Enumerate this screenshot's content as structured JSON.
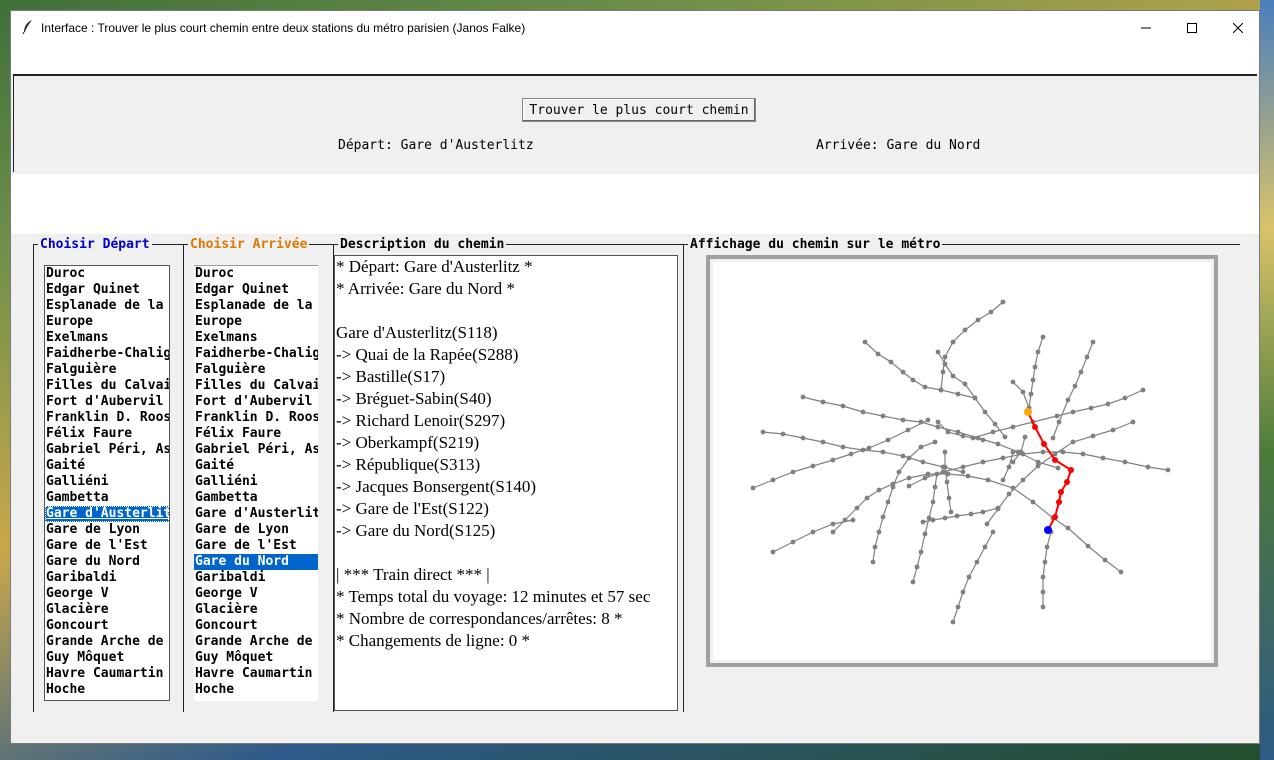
{
  "window": {
    "title": "Interface : Trouver le plus court chemin entre deux stations du métro parisien (Janos Falke)"
  },
  "top": {
    "find_button": "Trouver le plus court chemin",
    "departure_text": "Départ: Gare d'Austerlitz",
    "arrival_text": "Arrivée: Gare du Nord"
  },
  "departure": {
    "legend": "Choisir Départ",
    "legend_color": "#0000cc",
    "items": [
      "Duroc",
      "Edgar Quinet",
      "Esplanade de la",
      "Europe",
      "Exelmans",
      "Faidherbe-Chalig",
      "Falguière",
      "Filles du Calvai",
      "Fort d'Aubervil",
      "Franklin D. Roos",
      "Félix Faure",
      "Gabriel Péri, As",
      "Gaité",
      "Galliéni",
      "Gambetta",
      "Gare d'Austerlit",
      "Gare de Lyon",
      "Gare de l'Est",
      "Gare du Nord",
      "Garibaldi",
      "George V",
      "Glacière",
      "Goncourt",
      "Grande Arche de",
      "Guy Môquet",
      "Havre Caumartin",
      "Hoche"
    ],
    "selected_index": 15
  },
  "arrival": {
    "legend": "Choisir Arrivée",
    "legend_color": "#e07800",
    "items": [
      "Duroc",
      "Edgar Quinet",
      "Esplanade de la",
      "Europe",
      "Exelmans",
      "Faidherbe-Chalig",
      "Falguière",
      "Filles du Calvai",
      "Fort d'Aubervil",
      "Franklin D. Roos",
      "Félix Faure",
      "Gabriel Péri, As",
      "Gaité",
      "Galliéni",
      "Gambetta",
      "Gare d'Austerlit",
      "Gare de Lyon",
      "Gare de l'Est",
      "Gare du Nord",
      "Garibaldi",
      "George V",
      "Glacière",
      "Goncourt",
      "Grande Arche de",
      "Guy Môquet",
      "Havre Caumartin",
      "Hoche"
    ],
    "selected_index": 18
  },
  "description": {
    "legend": "Description du chemin",
    "lines": [
      "* Départ: Gare d'Austerlitz *",
      "* Arrivée: Gare du Nord *",
      "",
      "Gare d'Austerlitz(S118)",
      "-> Quai de la Rapée(S288)",
      "-> Bastille(S17)",
      "-> Bréguet-Sabin(S40)",
      "-> Richard Lenoir(S297)",
      "-> Oberkampf(S219)",
      "-> République(S313)",
      "-> Jacques Bonsergent(S140)",
      "-> Gare de l'Est(S122)",
      "-> Gare du Nord(S125)",
      "",
      "| *** Train direct *** |",
      "* Temps total du voyage: 12 minutes et 57 sec",
      "* Nombre de correspondances/arrêtes: 8 *",
      "* Changements de ligne: 0 *"
    ]
  },
  "map": {
    "legend": "Affichage du chemin sur le métro",
    "network_color": "#808080",
    "path_color": "#ff0000",
    "start_color": "#ffa500",
    "end_color": "#0000ff"
  }
}
